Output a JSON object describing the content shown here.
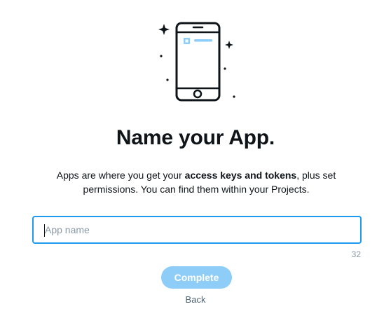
{
  "dialog": {
    "title": "Name your App.",
    "description_prefix": "Apps are where you get your ",
    "description_bold": "access keys and tokens",
    "description_suffix": ", plus set permissions. You can find them within your Projects.",
    "input": {
      "value": "",
      "placeholder": "App name"
    },
    "char_count": "32",
    "complete_label": "Complete",
    "back_label": "Back"
  },
  "colors": {
    "accent": "#1d9bf0",
    "button_disabled": "#8ecdf8",
    "text": "#0f1419",
    "muted": "#8b98a5"
  },
  "icons": [
    "phone-illustration",
    "sparkle-icon"
  ]
}
